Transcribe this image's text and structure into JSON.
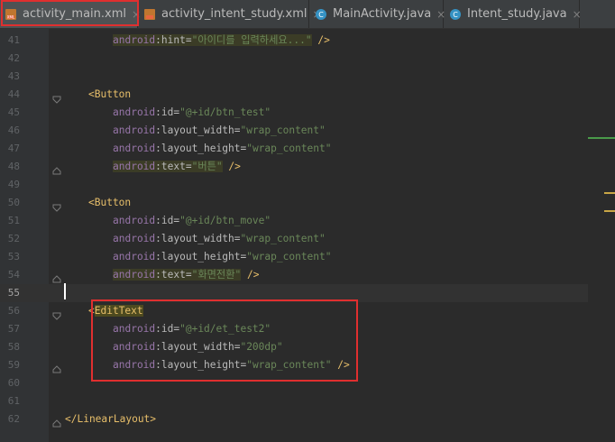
{
  "tabs": [
    {
      "label": "activity_main.xml",
      "icon": "xml-file-icon",
      "active": true
    },
    {
      "label": "activity_intent_study.xml",
      "icon": "xml-file-icon",
      "active": false
    },
    {
      "label": "MainActivity.java",
      "icon": "java-class-icon",
      "active": false
    },
    {
      "label": "Intent_study.java",
      "icon": "java-class-icon",
      "active": false
    }
  ],
  "close_glyph": "×",
  "code": {
    "line_numbers": [
      "41",
      "42",
      "43",
      "44",
      "45",
      "46",
      "47",
      "48",
      "49",
      "50",
      "51",
      "52",
      "53",
      "54",
      "55",
      "56",
      "57",
      "58",
      "59",
      "60",
      "61",
      "62"
    ],
    "hint_ns": "android",
    "hint_attr": ":hint=",
    "hint_value": "\"아이디를 입력하세요...\"",
    "close_slash": " />",
    "button_tag": "<Button",
    "id_attr": ":id=",
    "btn_test_id": "\"@+id/btn_test\"",
    "lw_attr": ":layout_width=",
    "lh_attr": ":layout_height=",
    "wrap_content": "\"wrap_content\"",
    "text_attr": ":text=",
    "btn_test_text": "\"버튼\"",
    "btn_move_id": "\"@+id/btn_move\"",
    "btn_move_text": "\"화면전환\"",
    "edit_open": "<",
    "edit_tag": "EditText",
    "et_id": "\"@+id/et_test2\"",
    "et_width": "\"200dp\"",
    "linear_close": "</LinearLayout>"
  },
  "colors": {
    "accent_red": "#e02f2f",
    "tag": "#e8bf6a",
    "namespace": "#9876aa",
    "string": "#6a8759"
  }
}
